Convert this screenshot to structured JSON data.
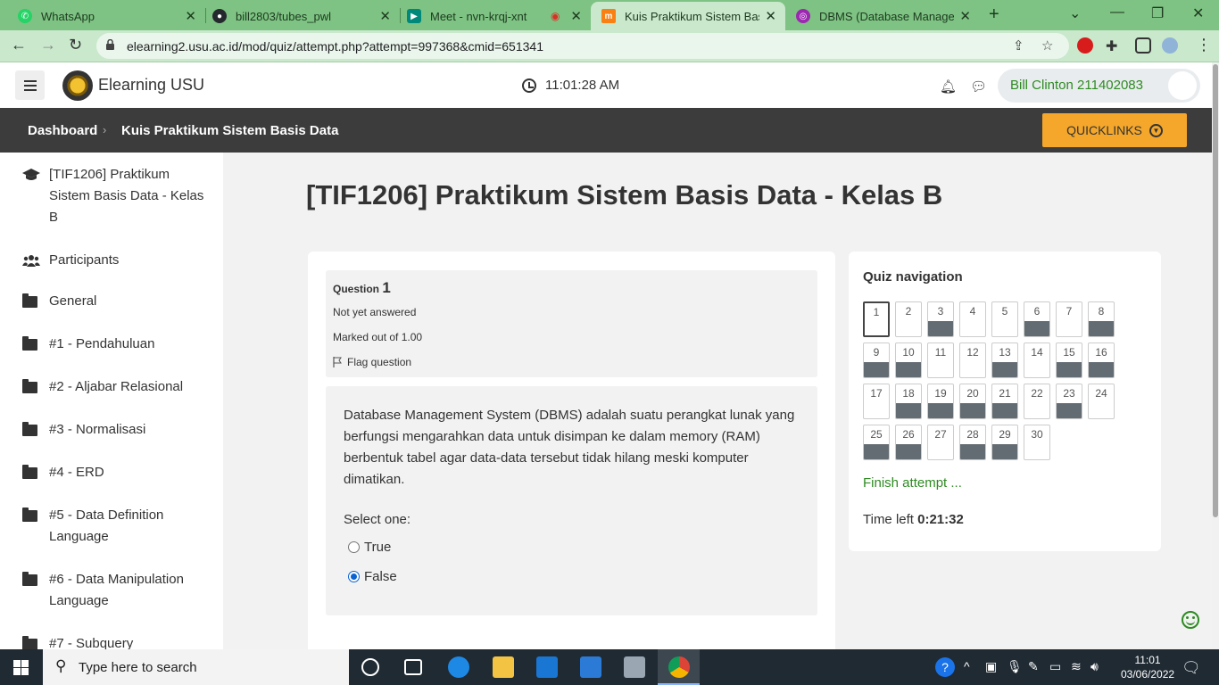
{
  "browser": {
    "tabs": [
      {
        "title": "WhatsApp",
        "icon": "whatsapp-icon",
        "color": "#25d366"
      },
      {
        "title": "bill2803/tubes_pwl",
        "icon": "github-icon",
        "color": "#24292e"
      },
      {
        "title": "Meet - nvn-krqj-xnt",
        "icon": "meet-icon",
        "color": "#00897b"
      },
      {
        "title": "Kuis Praktikum Sistem Basis Data",
        "icon": "moodle-icon",
        "color": "#f98012"
      },
      {
        "title": "DBMS (Database Manageme",
        "icon": "dbms-site-icon",
        "color": "#9c27b0"
      }
    ],
    "url": "elearning2.usu.ac.id/mod/quiz/attempt.php?attempt=997368&cmid=651341"
  },
  "header": {
    "site_name": "Elearning USU",
    "clock": "11:01:28 AM",
    "user_name": "Bill Clinton 211402083"
  },
  "breadcrumb": {
    "dashboard": "Dashboard",
    "current": "Kuis Praktikum Sistem Basis Data",
    "quicklinks": "QUICKLINKS"
  },
  "sidebar": {
    "items": [
      {
        "label": "[TIF1206] Praktikum Sistem Basis Data - Kelas B",
        "icon": "graduation-cap-icon"
      },
      {
        "label": "Participants",
        "icon": "users-icon"
      },
      {
        "label": "General",
        "icon": "folder-icon"
      },
      {
        "label": "#1 - Pendahuluan",
        "icon": "folder-icon"
      },
      {
        "label": "#2 - Aljabar Relasional",
        "icon": "folder-icon"
      },
      {
        "label": "#3 - Normalisasi",
        "icon": "folder-icon"
      },
      {
        "label": "#4 - ERD",
        "icon": "folder-icon"
      },
      {
        "label": "#5 - Data Definition Language",
        "icon": "folder-icon"
      },
      {
        "label": "#6 - Data Manipulation Language",
        "icon": "folder-icon"
      },
      {
        "label": "#7 - Subquery",
        "icon": "folder-icon"
      }
    ]
  },
  "main": {
    "course_title": "[TIF1206] Praktikum Sistem Basis Data - Kelas B",
    "question": {
      "label": "Question",
      "number": "1",
      "state": "Not yet answered",
      "marks": "Marked out of 1.00",
      "flag": "Flag question",
      "text": "Database Management System (DBMS) adalah suatu perangkat lunak yang berfungsi mengarahkan data untuk disimpan ke dalam memory (RAM) berbentuk tabel agar data-data tersebut tidak hilang meski komputer dimatikan.",
      "select_one": "Select one:",
      "options": [
        {
          "label": "True",
          "selected": false
        },
        {
          "label": "False",
          "selected": true
        }
      ]
    },
    "quiz_nav": {
      "title": "Quiz navigation",
      "current": 1,
      "answered": [
        3,
        6,
        8,
        9,
        10,
        13,
        15,
        16,
        18,
        19,
        20,
        21,
        23,
        25,
        26,
        28,
        29
      ],
      "buttons": [
        "1",
        "2",
        "3",
        "4",
        "5",
        "6",
        "7",
        "8",
        "9",
        "10",
        "11",
        "12",
        "13",
        "14",
        "15",
        "16",
        "17",
        "18",
        "19",
        "20",
        "21",
        "22",
        "23",
        "24",
        "25",
        "26",
        "27",
        "28",
        "29",
        "30"
      ],
      "finish": "Finish attempt ...",
      "time_label": "Time left",
      "time_value": "0:21:32"
    }
  },
  "taskbar": {
    "search_placeholder": "Type here to search",
    "time": "11:01",
    "date": "03/06/2022"
  }
}
